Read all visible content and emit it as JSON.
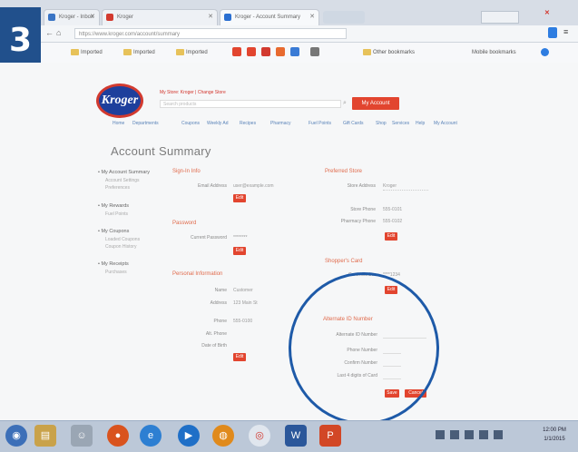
{
  "step_badge": "3",
  "browser": {
    "tabs": [
      {
        "label": "Kroger - Inbox",
        "fav_color": "#3a74c4"
      },
      {
        "label": "Kroger",
        "fav_color": "#d23a2f"
      },
      {
        "label": "Kroger - Account Summary",
        "fav_color": "#2a6fd1"
      }
    ],
    "url": "https://www.kroger.com/account/summary",
    "bookmarks": [
      "Imported",
      "Imported",
      "Imported"
    ],
    "bookmark_other": "Other bookmarks",
    "bookmark_mobile": "Mobile bookmarks"
  },
  "site": {
    "logo_text": "Kroger",
    "store_line": "My Store: Kroger | Change Store",
    "search_placeholder": "Search products",
    "sign_in_button": "My Account",
    "nav": [
      "Home",
      "Departments",
      "Coupons",
      "Weekly Ad",
      "Recipes",
      "Pharmacy",
      "Fuel Points",
      "Gift Cards",
      "Shop",
      "Services",
      "Help",
      "My Account"
    ]
  },
  "page_title": "Account Summary",
  "sidebar": [
    {
      "label": "My Account Summary",
      "sub": [
        "Account Settings",
        "Preferences"
      ]
    },
    {
      "label": "My Rewards",
      "sub": [
        "Fuel Points"
      ]
    },
    {
      "label": "My Coupons",
      "sub": [
        "Loaded Coupons",
        "Coupon History"
      ]
    },
    {
      "label": "My Receipts",
      "sub": [
        "Purchases"
      ]
    }
  ],
  "col1": {
    "sign_in": {
      "title": "Sign-In Info",
      "email_label": "Email Address",
      "email_value": "user@example.com",
      "button": "Edit"
    },
    "password": {
      "title": "Password",
      "label": "Current Password",
      "value": "********",
      "button": "Edit"
    },
    "personal": {
      "title": "Personal Information",
      "rows": [
        {
          "label": "Name",
          "value": "Customer"
        },
        {
          "label": "Address",
          "value": "123 Main St"
        },
        {
          "label": "Phone",
          "value": "555-0100"
        },
        {
          "label": "Alt. Phone",
          "value": ""
        },
        {
          "label": "Date of Birth",
          "value": ""
        }
      ],
      "button": "Edit"
    }
  },
  "col2": {
    "preferred_store": {
      "title": "Preferred Store",
      "rows": [
        {
          "label": "Store Address",
          "value": "Kroger"
        },
        {
          "label": "Store Phone",
          "value": "555-0101"
        },
        {
          "label": "Pharmacy Phone",
          "value": "555-0102"
        }
      ],
      "button": "Edit"
    },
    "shoppers_card": {
      "title": "Shopper's Card",
      "label": "Card Number",
      "value": "****1234",
      "button": "Edit"
    },
    "alt_id": {
      "title": "Alternate ID Number",
      "rows": [
        {
          "label": "Alternate ID Number",
          "value": ""
        },
        {
          "label": "Phone Number",
          "value": ""
        },
        {
          "label": "Confirm Number",
          "value": ""
        },
        {
          "label": "Last 4 digits of Card",
          "value": ""
        }
      ],
      "save": "Save",
      "cancel": "Cancel"
    }
  },
  "taskbar": {
    "clock_time": "12:00 PM",
    "clock_date": "1/1/2015"
  }
}
